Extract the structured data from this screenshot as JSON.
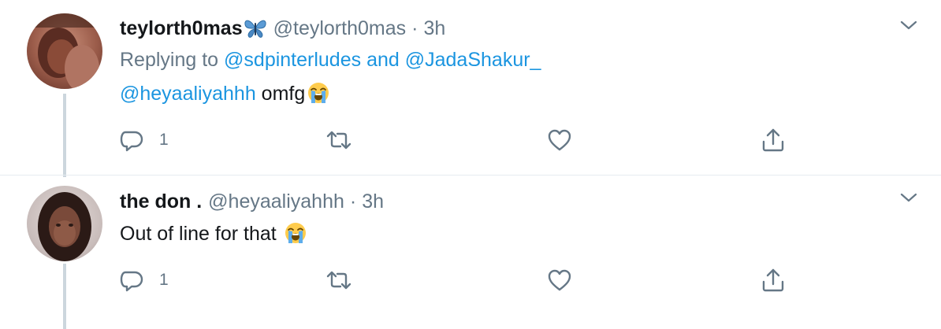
{
  "colors": {
    "text": "#14171a",
    "muted": "#657786",
    "link": "#1b95e0",
    "line": "#ccd6dd",
    "divider": "#e6ecf0"
  },
  "tweets": [
    {
      "display_name": "teylorth0mas",
      "name_emoji": "butterfly-emoji",
      "handle": "@teylorth0mas",
      "separator": "·",
      "time": "3h",
      "replying_to_prefix": "Replying to",
      "replying_to_user1": "@sdpinterludes",
      "replying_to_and": "and",
      "replying_to_user2": "@JadaShakur_",
      "mention": "@heyaaliyahhh",
      "text": "omfg",
      "text_emoji": "loudly-crying-face-emoji",
      "reply_count": "1",
      "retweet_count": "",
      "like_count": ""
    },
    {
      "display_name": "the don .",
      "handle": "@heyaaliyahhh",
      "separator": "·",
      "time": "3h",
      "text": "Out of line for that",
      "text_emoji": "loudly-crying-face-emoji",
      "reply_count": "1",
      "retweet_count": "",
      "like_count": ""
    }
  ],
  "icons": {
    "reply": "reply-icon",
    "retweet": "retweet-icon",
    "like": "heart-icon",
    "share": "share-icon",
    "menu": "chevron-down-icon"
  }
}
